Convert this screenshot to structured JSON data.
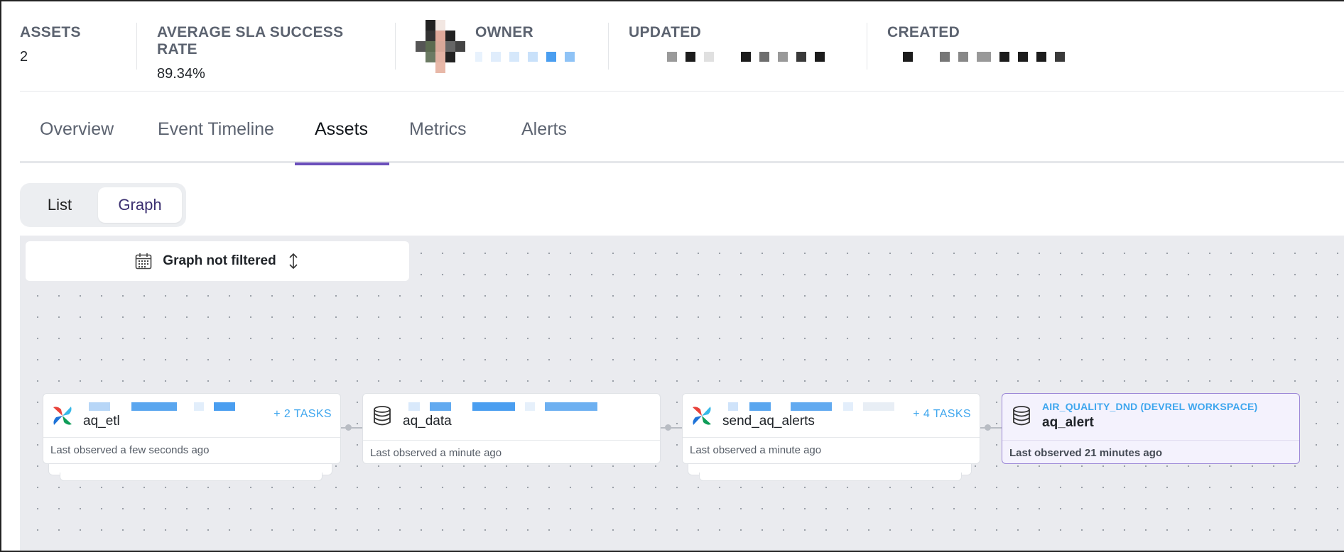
{
  "stats": {
    "assets": {
      "label": "ASSETS",
      "value": "2"
    },
    "sla": {
      "label": "AVERAGE SLA SUCCESS RATE",
      "value": "89.34%"
    },
    "owner": {
      "label": "OWNER"
    },
    "updated": {
      "label": "UPDATED"
    },
    "created": {
      "label": "CREATED"
    }
  },
  "tabs": [
    "Overview",
    "Event Timeline",
    "Assets",
    "Metrics",
    "Alerts"
  ],
  "active_tab": "Assets",
  "view_toggle": {
    "list": "List",
    "graph": "Graph",
    "selected": "Graph"
  },
  "graph_filter": {
    "label": "Graph not filtered",
    "icon": "calendar-icon",
    "sort_icon": "sort-arrows-icon"
  },
  "nodes": [
    {
      "name": "aq_etl",
      "icon": "airflow-icon",
      "tasks": "+ 2 TASKS",
      "observed": "Last observed a few seconds ago"
    },
    {
      "name": "aq_data",
      "icon": "database-icon",
      "observed": "Last observed a minute ago"
    },
    {
      "name": "send_aq_alerts",
      "icon": "airflow-icon",
      "tasks": "+ 4 TASKS",
      "observed": "Last observed a minute ago"
    },
    {
      "name": "aq_alert",
      "subname": "AIR_QUALITY_DND (DEVREL WORKSPACE)",
      "icon": "database-icon",
      "observed": "Last observed 21 minutes ago"
    }
  ],
  "colors": {
    "accent": "#6b4fbb",
    "link": "#3ea6ee",
    "canvas": "#eaebef"
  }
}
